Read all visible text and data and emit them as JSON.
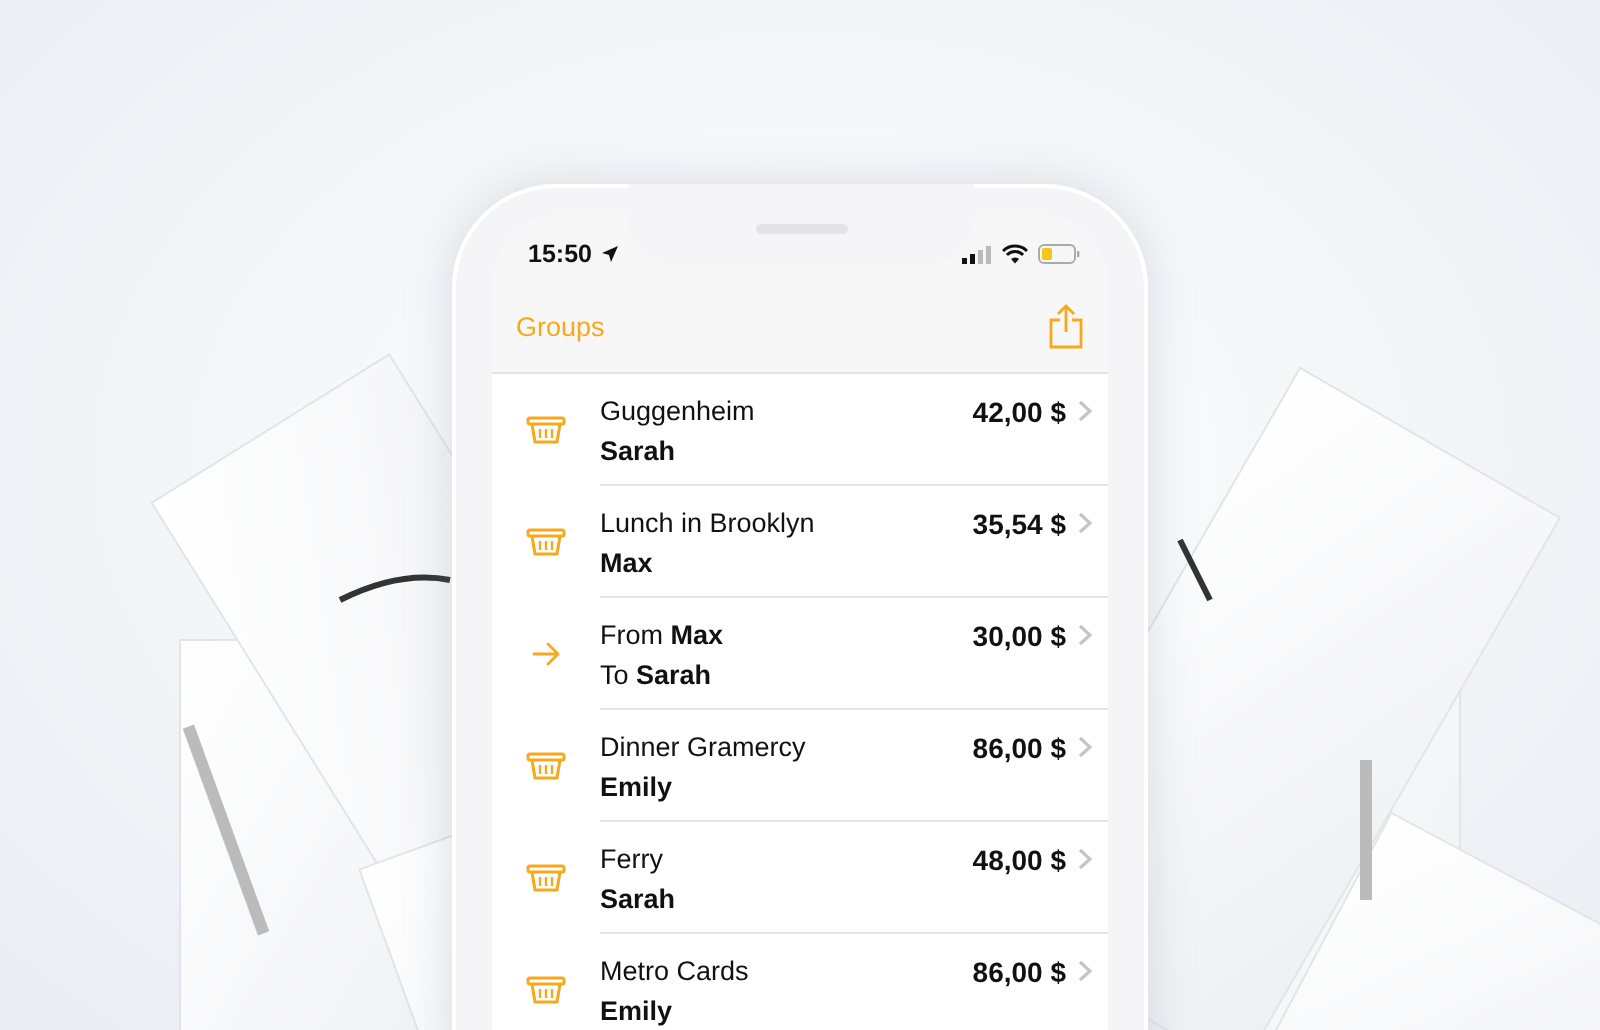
{
  "status_bar": {
    "time": "15:50"
  },
  "nav": {
    "back": "Groups"
  },
  "rows": [
    {
      "kind": "expense",
      "title": "Guggenheim",
      "person": "Sarah",
      "amount": "42,00 $"
    },
    {
      "kind": "expense",
      "title": "Lunch in Brooklyn",
      "person": "Max",
      "amount": "35,54 $"
    },
    {
      "kind": "transfer",
      "title": "From **Max**",
      "person": "To **Sarah**",
      "amount": "30,00 $"
    },
    {
      "kind": "expense",
      "title": "Dinner Gramercy",
      "person": "Emily",
      "amount": "86,00 $"
    },
    {
      "kind": "expense",
      "title": "Ferry",
      "person": "Sarah",
      "amount": "48,00 $"
    },
    {
      "kind": "expense",
      "title": "Metro Cards",
      "person": "Emily",
      "amount": "86,00 $"
    }
  ]
}
